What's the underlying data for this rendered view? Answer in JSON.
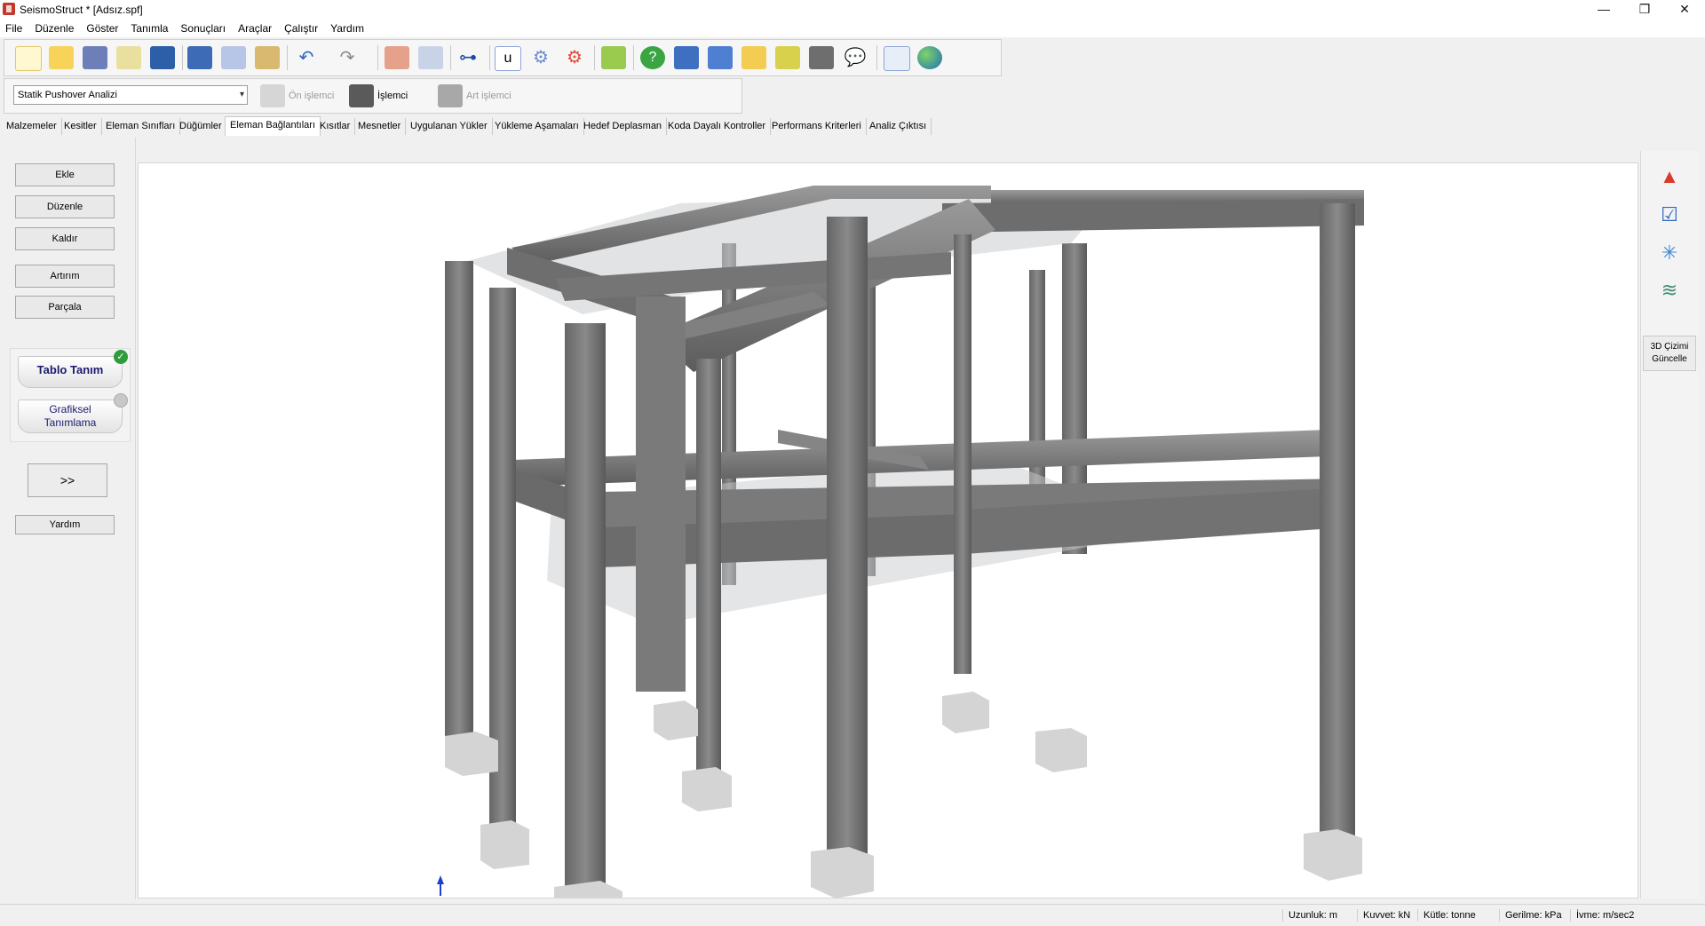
{
  "window": {
    "title": "SeismoStruct * [Adsız.spf]",
    "minimize_glyph": "—",
    "restore_glyph": "❐",
    "close_glyph": "✕"
  },
  "menu": [
    "File",
    "Düzenle",
    "Göster",
    "Tanımla",
    "Sonuçları",
    "Araçlar",
    "Çalıştır",
    "Yardım"
  ],
  "toolbar": {
    "icons": [
      "new-file-icon",
      "open-folder-icon",
      "building-icon",
      "wand-icon",
      "save-icon",
      "report-icon",
      "copy-icon",
      "paste-icon",
      "undo-icon",
      "redo-icon",
      "pre-processor-icon",
      "play-icon",
      "graph-icon",
      "u-icon",
      "gear-icon",
      "network-gear-icon",
      "brush-icon",
      "help-icon",
      "book-icon",
      "book-check-icon",
      "folder-icon",
      "folder-arrow-icon",
      "film-icon",
      "chat-icon",
      "edit-icon",
      "globe-icon"
    ]
  },
  "analysis": {
    "selected": "Statik Pushover Analizi",
    "pre_processor": "Ön işlemci",
    "processor": "İşlemci",
    "post_processor": "Art işlemci"
  },
  "tabs": [
    "Malzemeler",
    "Kesitler",
    "Eleman Sınıfları",
    "Düğümler",
    "Eleman Bağlantıları",
    "Kısıtlar",
    "Mesnetler",
    "Uygulanan Yükler",
    "Yükleme Aşamaları",
    "Hedef Deplasman",
    "Koda Dayalı Kontroller",
    "Performans Kriterleri",
    "Analiz Çıktısı"
  ],
  "active_tab": "Eleman Bağlantıları",
  "left_panel": {
    "add": "Ekle",
    "edit": "Düzenle",
    "remove": "Kaldır",
    "increment": "Artırım",
    "split": "Parçala",
    "table_mode": "Tablo Tanım",
    "graphic_mode_line1": "Grafiksel",
    "graphic_mode_line2": "Tanımlama",
    "more": ">>",
    "help": "Yardım"
  },
  "right_panel": {
    "icons": [
      "shapes-icon",
      "checklist-icon",
      "axes-icon",
      "layers-icon"
    ],
    "update_3d_line1": "3D Çizimi",
    "update_3d_line2": "Güncelle"
  },
  "status": {
    "length": "Uzunluk: m",
    "force": "Kuvvet: kN",
    "mass": "Kütle: tonne",
    "stress": "Gerilme: kPa",
    "accel": "İvme: m/sec2"
  },
  "colors": {
    "timber": "#7a7a7a",
    "timber_dark": "#5f5f5f",
    "timber_light": "#9a9a9a",
    "footing": "#d4d4d4",
    "slab": "#c9ccd0"
  }
}
